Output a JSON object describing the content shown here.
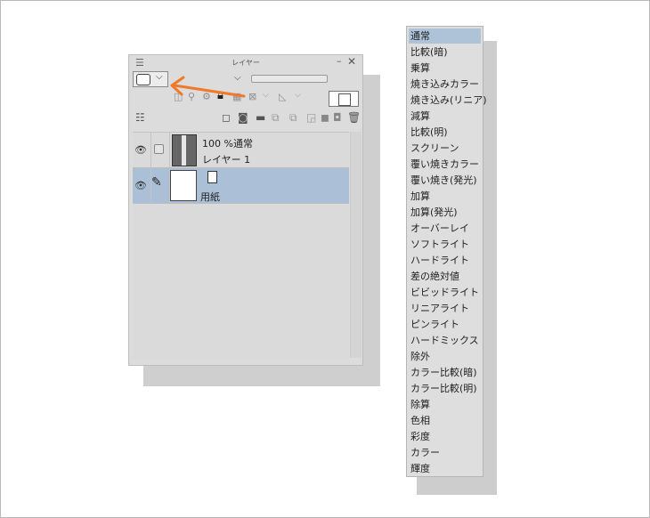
{
  "panel": {
    "title": "レイヤー",
    "menu_icon": "hamburger-icon",
    "minimize_icon": "minimize-icon",
    "close_icon": "close-icon",
    "blend_mode_icon": "blend-mode-icon",
    "chevron": "chevron-down-icon"
  },
  "layers": [
    {
      "line1": "100 %通常",
      "line2": "レイヤー 1"
    },
    {
      "name": "用紙"
    }
  ],
  "blend_modes": [
    "通常",
    "比較(暗)",
    "乗算",
    "焼き込みカラー",
    "焼き込み(リニア)",
    "減算",
    "比較(明)",
    "スクリーン",
    "覆い焼きカラー",
    "覆い焼き(発光)",
    "加算",
    "加算(発光)",
    "オーバーレイ",
    "ソフトライト",
    "ハードライト",
    "差の絶対値",
    "ビビッドライト",
    "リニアライト",
    "ピンライト",
    "ハードミックス",
    "除外",
    "カラー比較(暗)",
    "カラー比較(明)",
    "除算",
    "色相",
    "彩度",
    "カラー",
    "輝度"
  ],
  "selected_blend_mode": "通常",
  "colors": {
    "selection": "#abc0d6",
    "arrow": "#f07a2a",
    "panel_bg": "#dcdcdc"
  }
}
